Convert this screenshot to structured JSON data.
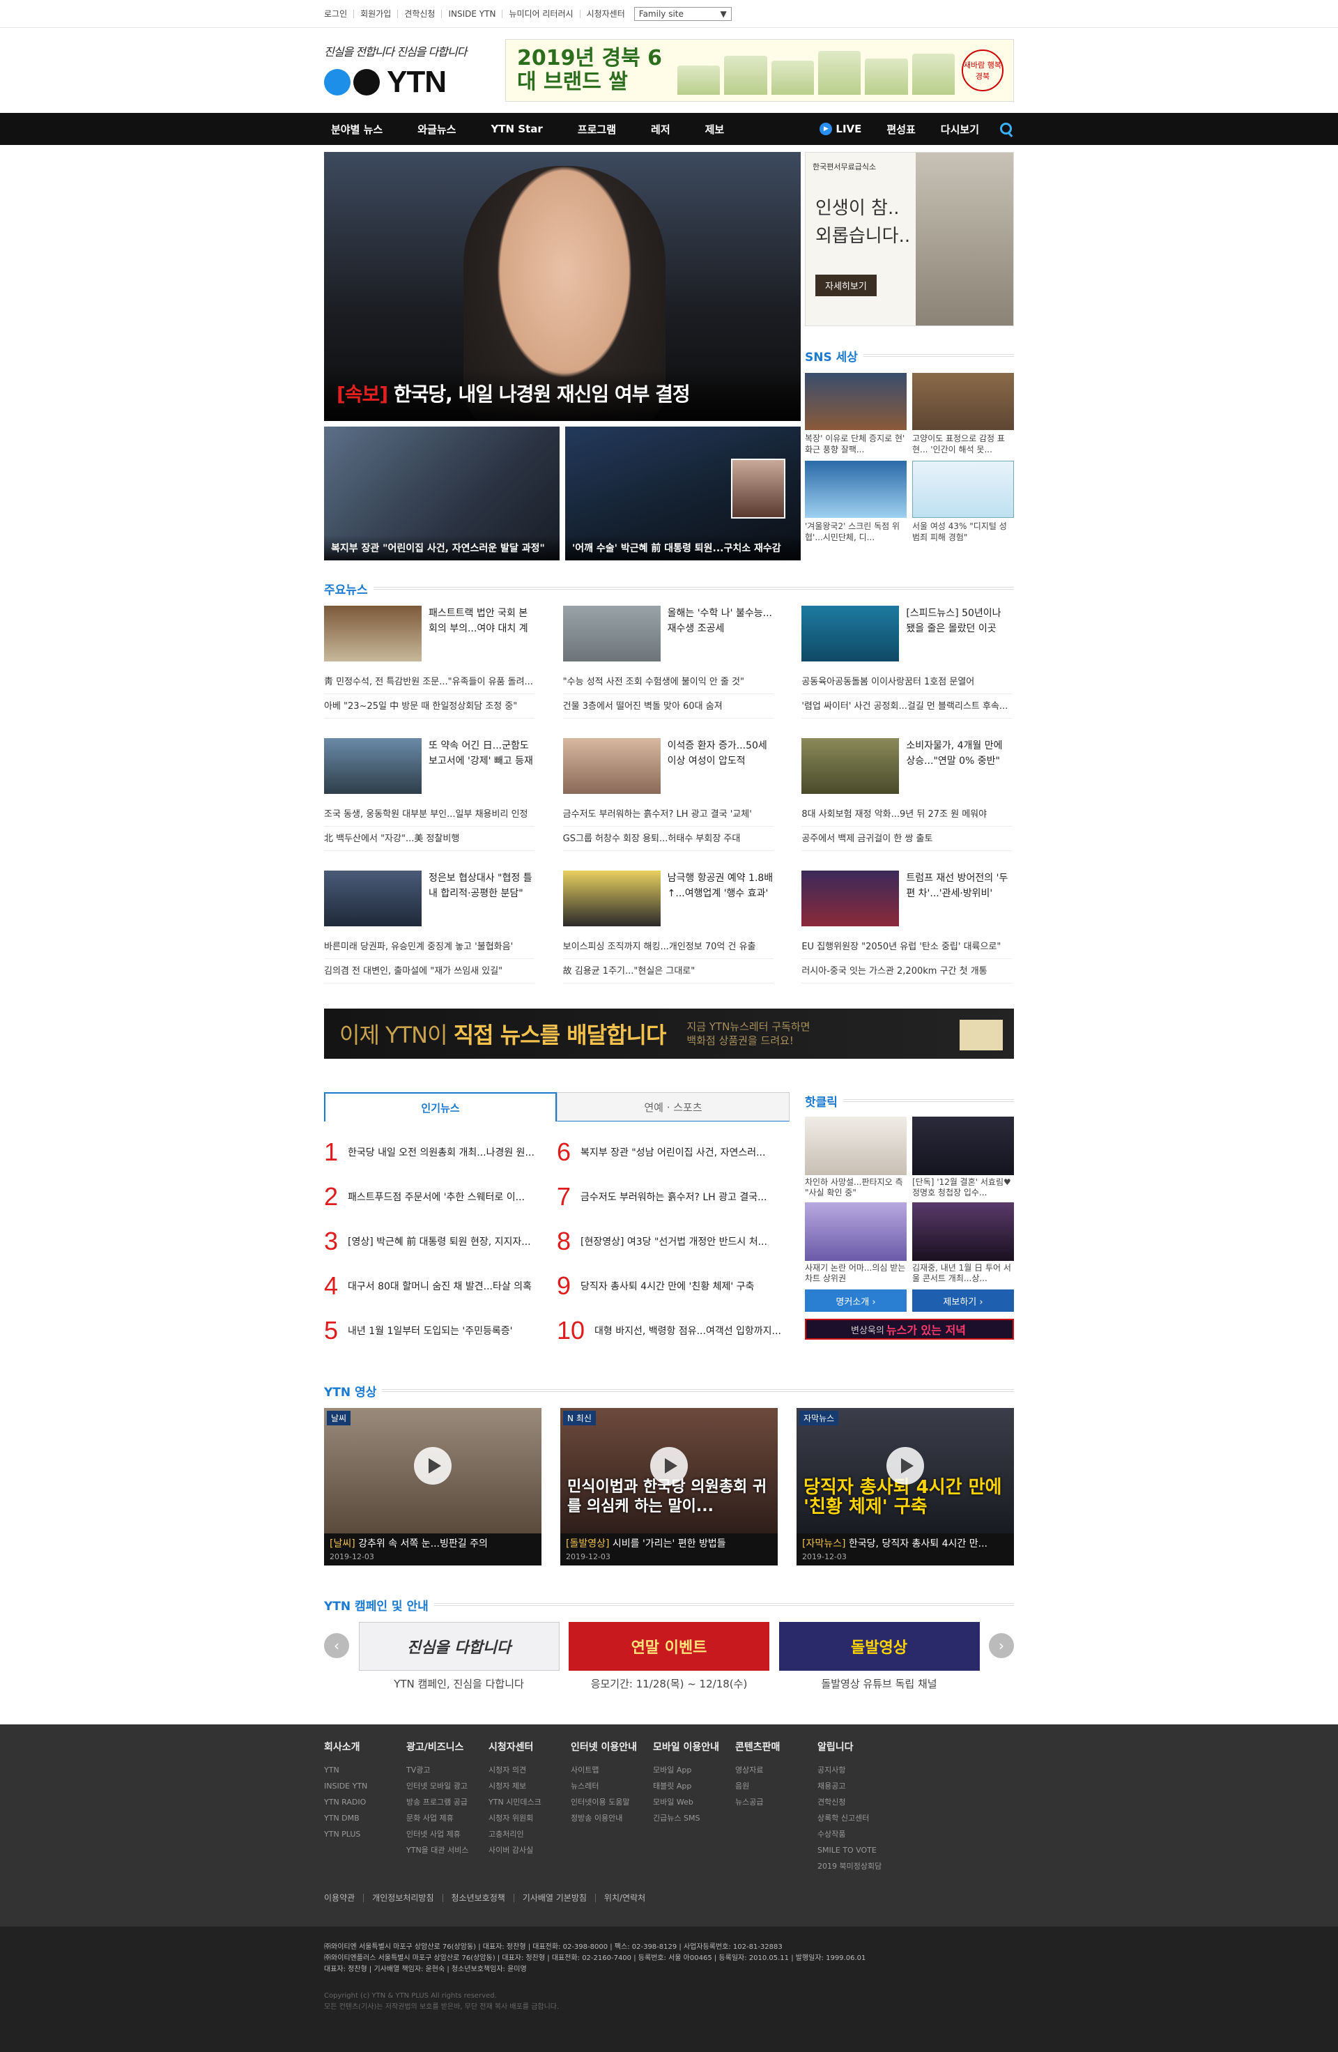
{
  "topbar": {
    "links": [
      "로그인",
      "회원가입",
      "견학신청",
      "INSIDE YTN",
      "뉴미디어 리터러시",
      "시청자센터"
    ],
    "family_site": "Family site"
  },
  "header": {
    "slogan": "진실을 전합니다 진심을 다합니다",
    "logo_text": "YTN",
    "ad_title": "2019년 경북 6대 브랜드 쌀",
    "ad_seal": "새바람 행복경북"
  },
  "nav": {
    "menu": [
      "분야별 뉴스",
      "와글뉴스",
      "YTN Star",
      "프로그램",
      "레저",
      "제보"
    ],
    "live": "LIVE",
    "schedule": "편성표",
    "replay": "다시보기"
  },
  "hero": {
    "breaking": "[속보]",
    "headline": "한국당, 내일 나경원 재신임 여부 결정",
    "sub1": "복지부 장관 \"어린이집 사건, 자연스러운 발달 과정\"",
    "sub2": "'어깨 수술' 박근혜 前 대통령 퇴원...구치소 재수감"
  },
  "side_ad": {
    "org": "한국편서무료급식소",
    "msg1": "인생이 참..",
    "msg2": "외롭습니다..",
    "button": "자세히보기"
  },
  "sns": {
    "title": "SNS 세상",
    "items": [
      "복장' 이유로 단체 증지로 현' 화근 풍향 잘팩...",
      "고양이도 표정으로 감정 표현... '인간이 해석 못...",
      "'겨울왕국2' 스크린 독점 위협'...시민단체, 디...",
      "서울 여성 43% \"디지털 성범죄 피해 경험\""
    ]
  },
  "major": {
    "title": "주요뉴스",
    "cols": [
      [
        {
          "top": "패스트트랙 법안 국회 본회의 부의...여야 대치 계속",
          "list": [
            "靑 민정수석, 전 특감반원 조문...\"유족들이 유품 돌려...",
            "아베 \"23~25일 中 방문 때 한일정상회담 조정 중\""
          ]
        },
        {
          "top": "또 약속 어긴 日...군함도 보고서에 '강제' 빼고 등재",
          "list": [
            "조국 동생, 웅동학원 대부분 부인...일부 채용비리 인정",
            "北 백두산에서 \"자강\"...美 정찰비행"
          ]
        },
        {
          "top": "정은보 협상대사 \"협정 틀 내 합리적·공평한 분담\"",
          "list": [
            "바른미래 당권파, 유승민계 중징계 놓고 '불협화음'",
            "김의겸 전 대변인, 출마설에 \"재가 쓰임새 있길\""
          ]
        }
      ],
      [
        {
          "top": "올해는 '수학 나' 불수능...재수생 조공세",
          "list": [
            "\"수능 성적 사전 조회 수험생에 불이익 안 줄 것\"",
            "건물 3층에서 떨어진 벽돌 맞아 60대 숨져"
          ]
        },
        {
          "top": "이석증 환자 증가...50세 이상 여성이 압도적",
          "list": [
            "금수저도 부러워하는 흙수저? LH 광고 결국 '교체'",
            "GS그룹 허창수 회장 용퇴...허태수 부회장 주대"
          ]
        },
        {
          "top": "남극행 항공권 예약 1.8배↑...여행업계 '행수 효과'",
          "list": [
            "보이스피싱 조직까지 해킹...개인정보 70억 건 유출",
            "故 김용균 1주기...\"현실은 그대로\""
          ]
        }
      ],
      [
        {
          "top": "[스피드뉴스] 50년이나 됐을 줄은 몰랐던 이곳",
          "list": [
            "공동육아공동돌봄 이이사랑꿈터 1호점 문열어",
            "'렴업 싸이터' 사건 공정회...걸길 먼 블랙리스트 후속..."
          ]
        },
        {
          "top": "소비자물가, 4개월 만에 상승...\"연말 0% 중반\"",
          "list": [
            "8대 사회보험 재정 악화...9년 뒤 27조 원 메워야",
            "공주에서 백제 금귀걸이 한 쌍 출토"
          ]
        },
        {
          "top": "트럼프 재선 방어전의 '두 편 차'...'관세·방위비'",
          "list": [
            "EU 집행위원장 \"2050년 유럽 '탄소 중립' 대륙으로\"",
            "러시아-중국 잇는 가스관 2,200km 구간 첫 개통"
          ]
        }
      ]
    ]
  },
  "banner": {
    "line1_a": "이제 YTN이",
    "line1_b": "직접 뉴스를 배달합니다",
    "line2": "지금 YTN뉴스레터 구독하면",
    "line3": "백화점 상품권을 드려요!"
  },
  "popular": {
    "tab_on": "인기뉴스",
    "tab_off": "연예 · 스포츠",
    "items": [
      {
        "n": "1",
        "t": "한국당 내일 오전 의원총회 개최...나경원 원..."
      },
      {
        "n": "2",
        "t": "패스트푸드점 주문서에 '추한 스웨터로 이..."
      },
      {
        "n": "3",
        "t": "[영상] 박근혜 前 대통령 퇴원 현장, 지지자..."
      },
      {
        "n": "4",
        "t": "대구서 80대 할머니 숨진 채 발견...타살 의혹"
      },
      {
        "n": "5",
        "t": "내년 1월 1일부터 도입되는 '주민등록증'"
      },
      {
        "n": "6",
        "t": "복지부 장관 \"성남 어린이집 사건, 자연스러..."
      },
      {
        "n": "7",
        "t": "금수저도 부러워하는 흙수저? LH 광고 결국..."
      },
      {
        "n": "8",
        "t": "[현장영상] 여3당 \"선거법 개정안 반드시 처..."
      },
      {
        "n": "9",
        "t": "당직자 총사퇴 4시간 만에 '친황 체제' 구축"
      },
      {
        "n": "10",
        "t": "대형 바지선, 백령항 점유...여객선 입항까지..."
      }
    ]
  },
  "hotclick": {
    "title": "핫클릭",
    "items": [
      "차인하 사망설...판타지오 측 \"사실 확인 중\"",
      "[단독] '12월 결혼' 서효림♥정명호 청첩장 입수...",
      "사재기 논란 어마...의심 받는 차트 상위권",
      "김재중, 내년 1월 日 투어 서울 콘서트 개최...상..."
    ],
    "btn1": "명커소개 ›",
    "btn2": "제보하기 ›",
    "banner_a": "변상욱의",
    "banner_b": "뉴스가 있는 저녁"
  },
  "videos": {
    "title": "YTN 영상",
    "items": [
      {
        "tag": "날씨",
        "br": "[날씨]",
        "t": " 강추위 속 서쪽 눈...빙판길 주의",
        "d": "2019-12-03",
        "ov": ""
      },
      {
        "tag": "N 최신",
        "br": "[돌발영상]",
        "t": " 시비를 '가리는' 편한 방법들",
        "d": "2019-12-03",
        "ov": "민식이법과 한국당 의원총회 귀를 의심케 하는 말이..."
      },
      {
        "tag": "자막뉴스",
        "br": "[자막뉴스]",
        "t": " 한국당, 당직자 총사퇴 4시간 만...",
        "d": "2019-12-03",
        "ov": "당직자 총사퇴 4시간 만에 '친황 체제' 구축"
      }
    ]
  },
  "campaign": {
    "title": "YTN 캠페인 및 안내",
    "items": [
      {
        "img": "진심을 다합니다",
        "t": "YTN 캠페인, 진심을 다합니다"
      },
      {
        "img": "연말 이벤트",
        "t": "응모기간: 11/28(목) ~ 12/18(수)"
      },
      {
        "img": "돌발영상",
        "t": "돌발영상 유튜브 독립 채널"
      }
    ]
  },
  "footer": {
    "cols": [
      {
        "h": "회사소개",
        "items": [
          "YTN",
          "INSIDE YTN",
          "YTN RADIO",
          "YTN DMB",
          "YTN PLUS"
        ]
      },
      {
        "h": "광고/비즈니스",
        "items": [
          "TV광고",
          "인터넷 모바일 광고",
          "방송 프로그램 공급",
          "문화 사업 제휴",
          "인터넷 사업 제휴",
          "YTN을 대관 서비스"
        ]
      },
      {
        "h": "시청자센터",
        "items": [
          "시청자 의견",
          "시청자 제보",
          "YTN 시민데스크",
          "시청자 위원회",
          "고충처리인",
          "사이버 감사실"
        ]
      },
      {
        "h": "인터넷 이용안내",
        "items": [
          "사이트맵",
          "뉴스레터",
          "인터넷이용 도움말",
          "정방송 이용안내"
        ]
      },
      {
        "h": "모바일 이용안내",
        "items": [
          "모바일 App",
          "태블릿 App",
          "모바일 Web",
          "긴급뉴스 SMS"
        ]
      },
      {
        "h": "콘텐츠판매",
        "items": [
          "영상자료",
          "음원",
          "뉴스공급"
        ]
      },
      {
        "h": "알립니다",
        "items": [
          "공지사항",
          "채용공고",
          "견학신청",
          "상록학 신고센터",
          "수상작품",
          "SMILE TO VOTE",
          "2019 북미정상회담"
        ]
      }
    ],
    "links": [
      "이용약관",
      "개인정보처리방침",
      "청소년보호정책",
      "기사배열 기본방침",
      "위치/연락처"
    ],
    "info1": "㈜와이티엔 서울특별시 마포구 상암산로 76(상암동) | 대표자: 정찬형 | 대표전화: 02-398-8000 | 팩스: 02-398-8129 | 사업자등록번호: 102-81-32883",
    "info2": "㈜와이티엔플러스 서울특별시 마포구 상암산로 76(상암동) | 대표자: 정찬형 | 대표전화: 02-2160-7400 | 등록번호: 서울 아00465 | 등록일자: 2010.05.11 | 발행일자: 1999.06.01",
    "info3": "대표자: 정찬형 | 기사배열 책임자: 윤현숙 | 청소년보호책임자: 윤미영",
    "copy1": "Copyright (c) YTN & YTN PLUS All rights reserved.",
    "copy2": "모든 컨텐츠(기사)는 저작권법의 보호를 받은바, 무단 전재 복사 배포를 금합니다."
  },
  "colors": {
    "accent": "#1a7ad0",
    "rank_red": "#e01b1b",
    "nav_bg": "#111111",
    "footer_bg": "#333333",
    "logo_blue": "#1d8fe8",
    "logo_black": "#111111"
  }
}
